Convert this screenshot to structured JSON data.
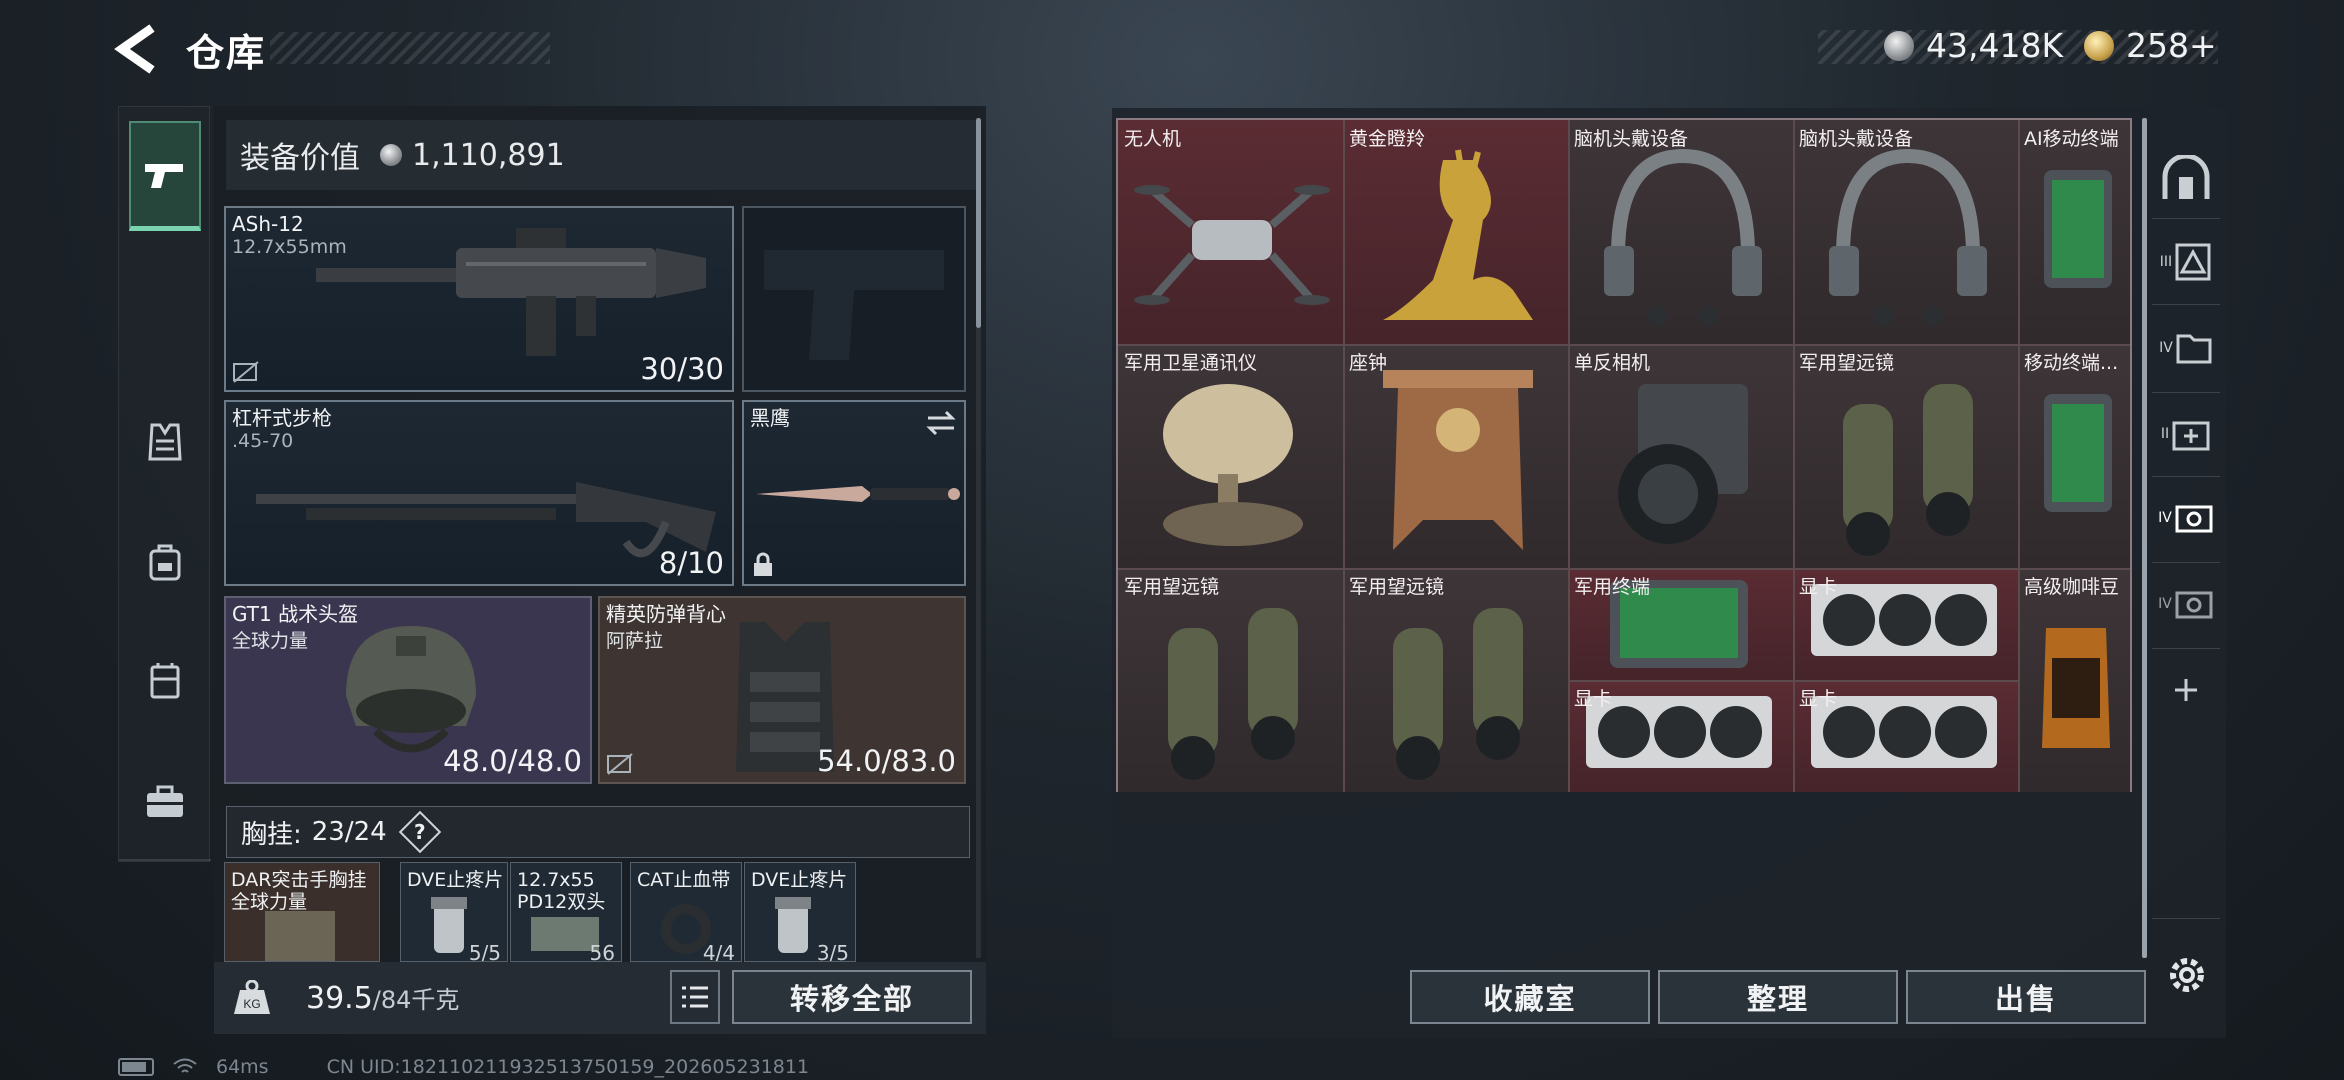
{
  "header": {
    "title": "仓库"
  },
  "currency": {
    "silver": "43,418K",
    "gold": "258+"
  },
  "equipment": {
    "value_label": "装备价值",
    "value": "1,110,891"
  },
  "weapons": {
    "primary": {
      "name": "ASh-12",
      "caliber": "12.7x55mm",
      "ammo": "30/30"
    },
    "secondary": {
      "name": "杠杆式步枪",
      "caliber": ".45-70",
      "ammo": "8/10"
    },
    "melee": {
      "name": "黑鹰"
    }
  },
  "armor": {
    "helmet": {
      "name": "GT1 战术头盔",
      "maker": "全球力量",
      "durability": "48.0/48.0"
    },
    "vest": {
      "name": "精英防弹背心",
      "maker": "阿萨拉",
      "durability": "54.0/83.0"
    }
  },
  "chest_rig": {
    "label": "胸挂:",
    "capacity": "23/24",
    "help": "?",
    "items": [
      {
        "name": "DAR突击手胸挂",
        "sub": "全球力量",
        "count": ""
      },
      {
        "name": "DVE止疼片",
        "sub": "",
        "count": "5/5"
      },
      {
        "name": "12.7x55",
        "sub": "PD12双头",
        "count": "56"
      },
      {
        "name": "CAT止血带",
        "sub": "",
        "count": "4/4"
      },
      {
        "name": "DVE止疼片",
        "sub": "",
        "count": "3/5"
      }
    ]
  },
  "footer_left": {
    "weight": "39.5",
    "weight_max": "/84千克",
    "transfer_label": "转移全部"
  },
  "grid_items": [
    {
      "name": "无人机",
      "color": "red"
    },
    {
      "name": "黄金瞪羚",
      "color": "red"
    },
    {
      "name": "脑机头戴设备",
      "color": "brown"
    },
    {
      "name": "脑机头戴设备",
      "color": "brown"
    },
    {
      "name": "AI移动终端",
      "color": "brown"
    },
    {
      "name": "军用卫星通讯仪",
      "color": "brown"
    },
    {
      "name": "座钟",
      "color": "brown"
    },
    {
      "name": "单反相机",
      "color": "brown"
    },
    {
      "name": "军用望远镜",
      "color": "brown"
    },
    {
      "name": "移动终端...",
      "color": "brown"
    },
    {
      "name": "军用望远镜",
      "color": "brown"
    },
    {
      "name": "军用望远镜",
      "color": "brown"
    },
    {
      "name": "军用终端",
      "color": "red"
    },
    {
      "name": "显卡",
      "color": "red"
    },
    {
      "name": "高级咖啡豆",
      "color": "brown"
    },
    {
      "name": "显卡",
      "color": "red"
    },
    {
      "name": "显卡",
      "color": "red"
    }
  ],
  "footer_right": {
    "collection": "收藏室",
    "sort": "整理",
    "sell": "出售"
  },
  "right_rail": [
    "III",
    "IV",
    "II",
    "IV",
    "IV"
  ],
  "status": {
    "ping": "64ms",
    "uid": "CN UID:18211021193251375015​9_202605231811"
  }
}
